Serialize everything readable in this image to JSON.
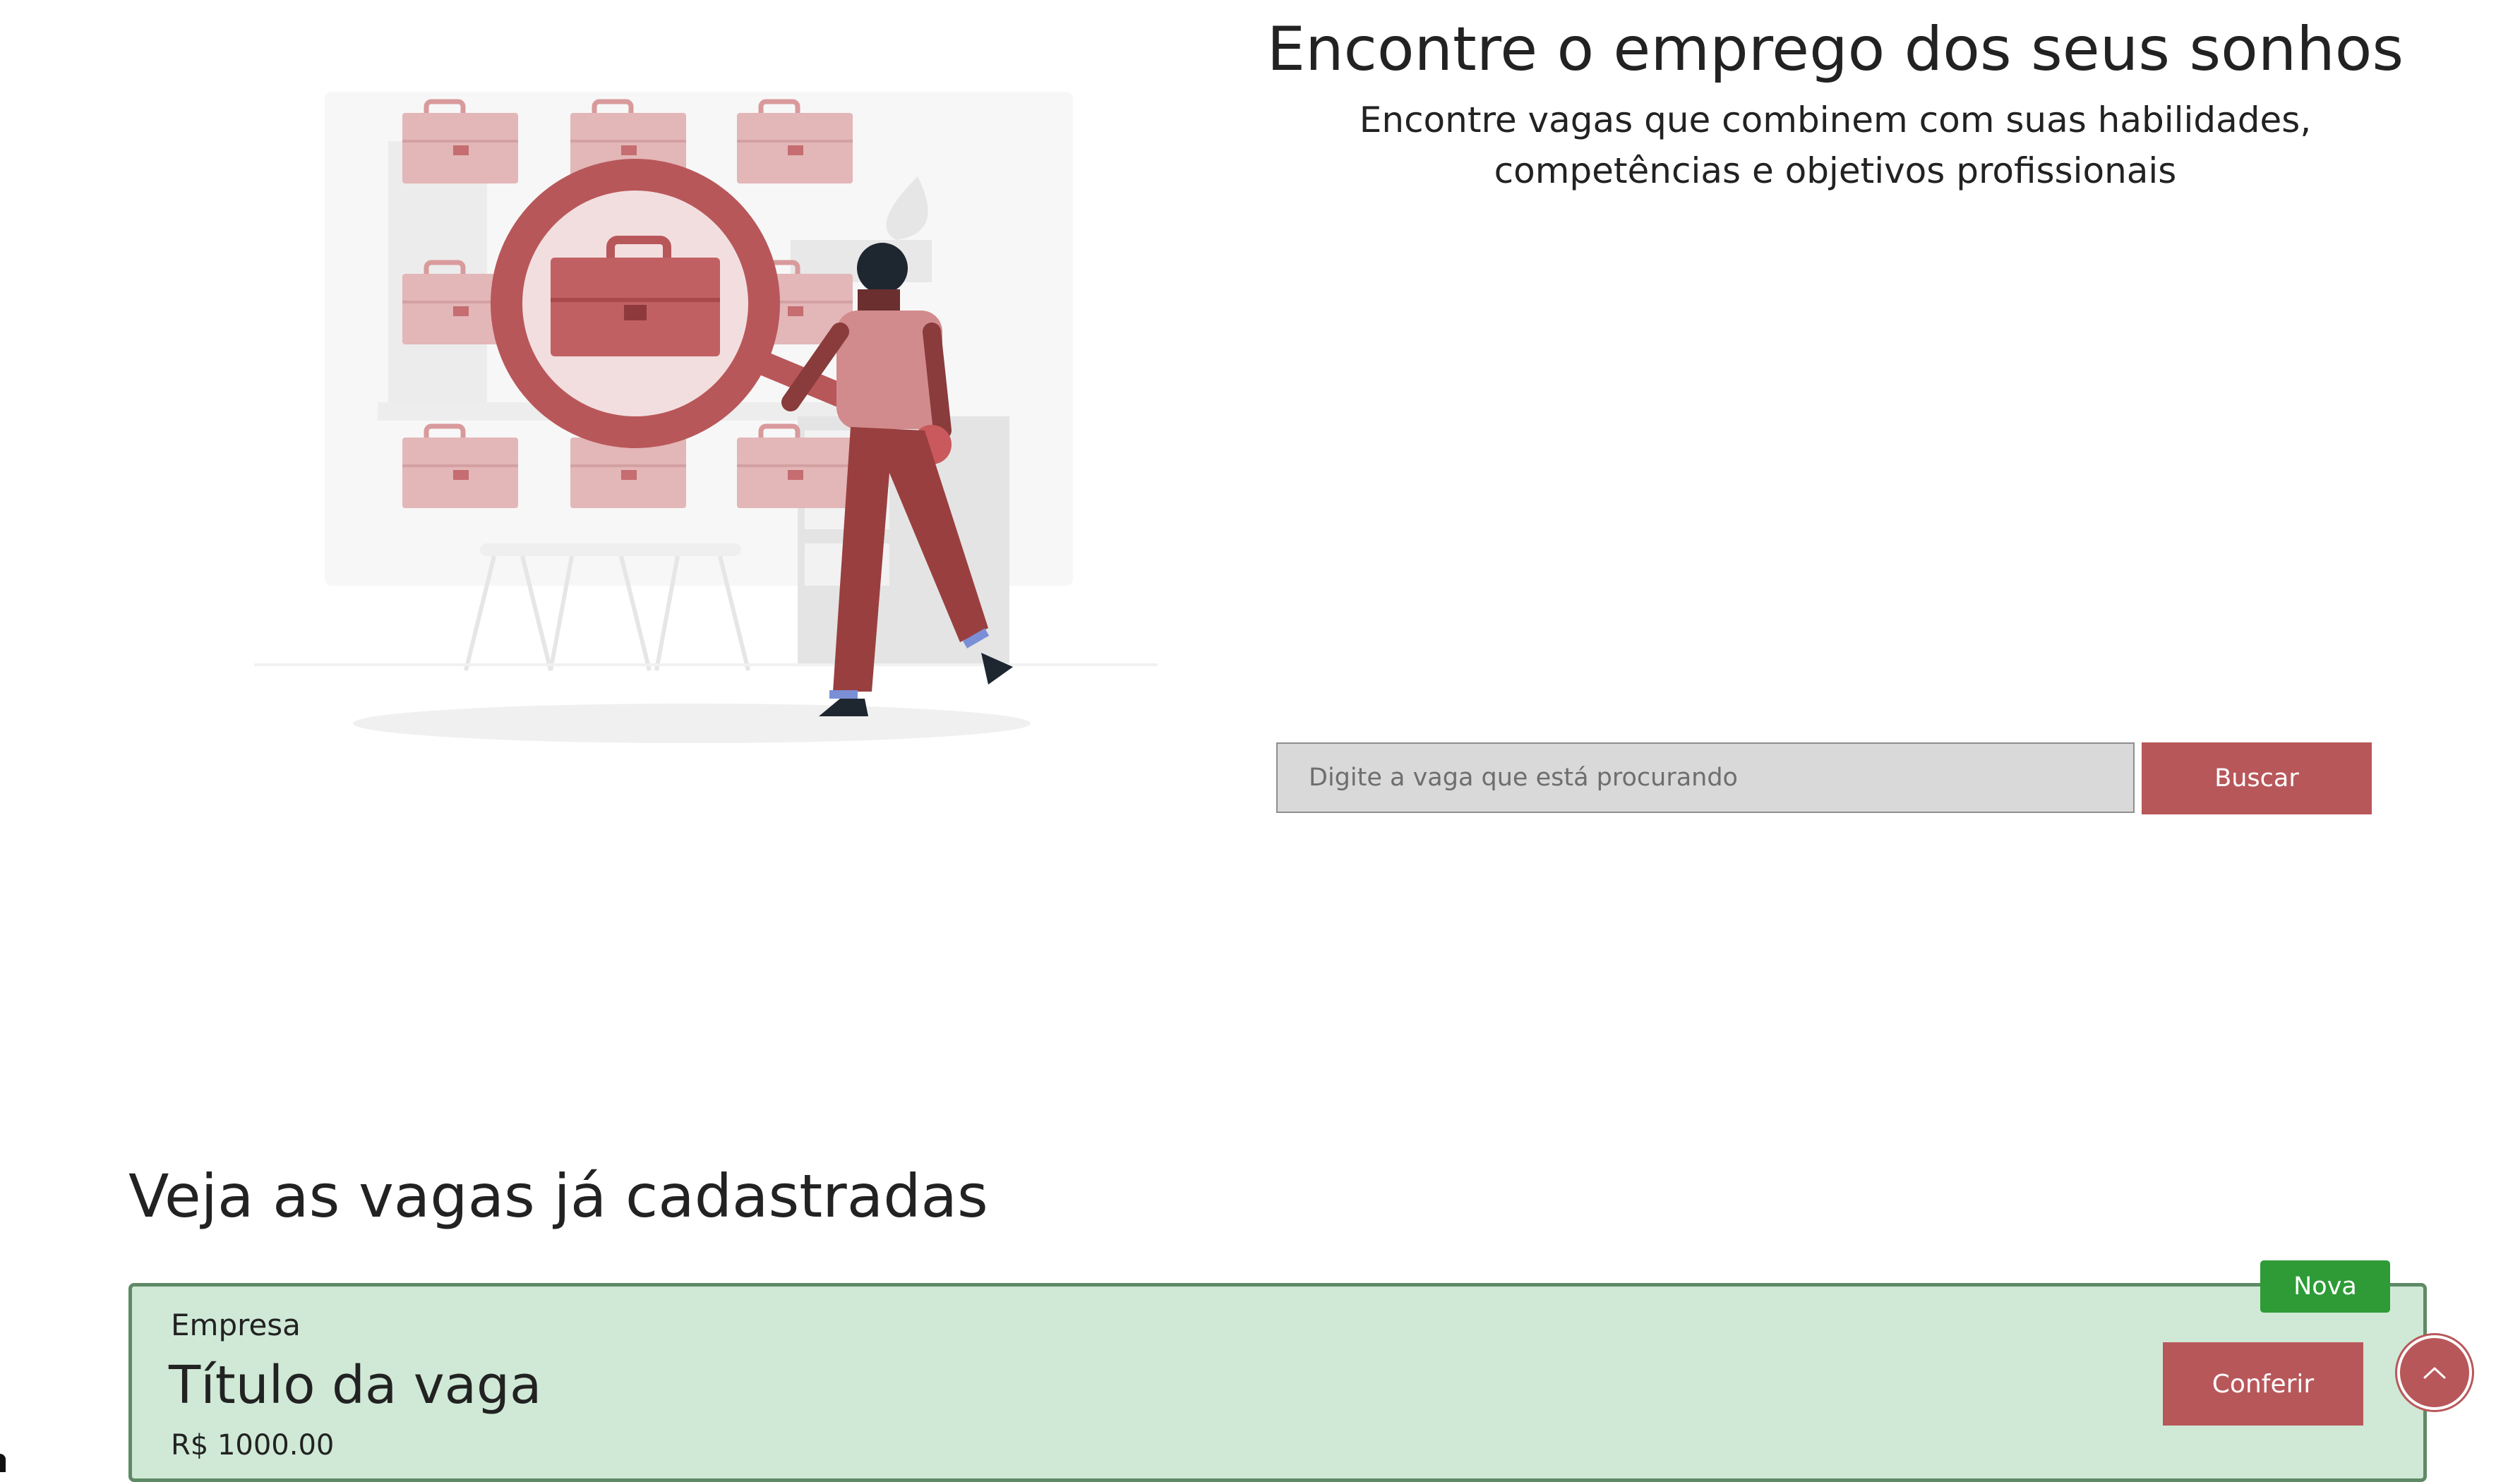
{
  "hero": {
    "title": "Encontre o emprego dos seus sonhos",
    "subtitle_line1": "Encontre vagas que combinem com suas habilidades,",
    "subtitle_line2": "competências e objetivos profissionais",
    "illustration": "person-with-magnifier-over-briefcases-illustration"
  },
  "search": {
    "placeholder": "Digite a vaga que está procurando",
    "value": "",
    "button_label": "Buscar"
  },
  "jobs_section": {
    "title": "Veja as vagas já cadastradas",
    "items": [
      {
        "company": "Empresa",
        "title": "Título da vaga",
        "salary": "R$ 1000.00",
        "badge": "Nova",
        "action_label": "Conferir"
      }
    ]
  },
  "back_to_top": {
    "icon": "chevron-up-icon"
  },
  "colors": {
    "accent": "#b8575a",
    "card_background": "#cfe9d6",
    "card_border": "#5f8a66",
    "badge_new": "#2e9b37",
    "input_background": "#d9d9d9"
  }
}
